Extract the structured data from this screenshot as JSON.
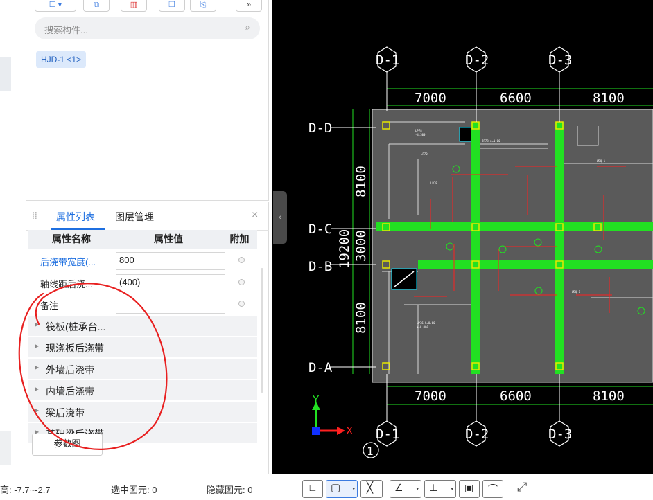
{
  "search": {
    "placeholder": "搜索构件..."
  },
  "component_chip": "HJD-1 <1>",
  "prop_panel": {
    "tabs": [
      "属性列表",
      "图层管理"
    ],
    "headers": {
      "name": "属性名称",
      "value": "属性值",
      "extra": "附加"
    },
    "rows": [
      {
        "name": "后浇带宽度(...",
        "value": "800"
      },
      {
        "name": "轴线距后浇...",
        "value": "(400)"
      },
      {
        "name": "备注",
        "value": ""
      }
    ],
    "groups": [
      "筏板(桩承台...",
      "现浇板后浇带",
      "外墙后浇带",
      "内墙后浇带",
      "梁后浇带",
      "基础梁后浇带"
    ],
    "param_button": "参数图"
  },
  "statusbar": {
    "elevation": "高:  -7.7~-2.7",
    "selected": "选中图元: 0",
    "hidden": "隐藏图元: 0"
  },
  "drawing": {
    "axes_top": [
      "D-1",
      "D-2",
      "D-3"
    ],
    "axes_left": [
      "D-D",
      "D-C",
      "D-B",
      "D-A"
    ],
    "dims_top": [
      "7000",
      "6600",
      "8100"
    ],
    "dims_bottom": [
      "7000",
      "6600",
      "8100"
    ],
    "dims_left": [
      "8100",
      "3000",
      "8100"
    ],
    "dim_total_left": "19200",
    "ucs_x": "X",
    "ucs_y": "Y",
    "floor_label": "1",
    "colors": {
      "canvas": "#000000",
      "slab": "#5a5a5a",
      "beam": "#22e022",
      "axis": "#ffffff",
      "red_line": "#ff2020",
      "annotation": "#e82020"
    }
  }
}
